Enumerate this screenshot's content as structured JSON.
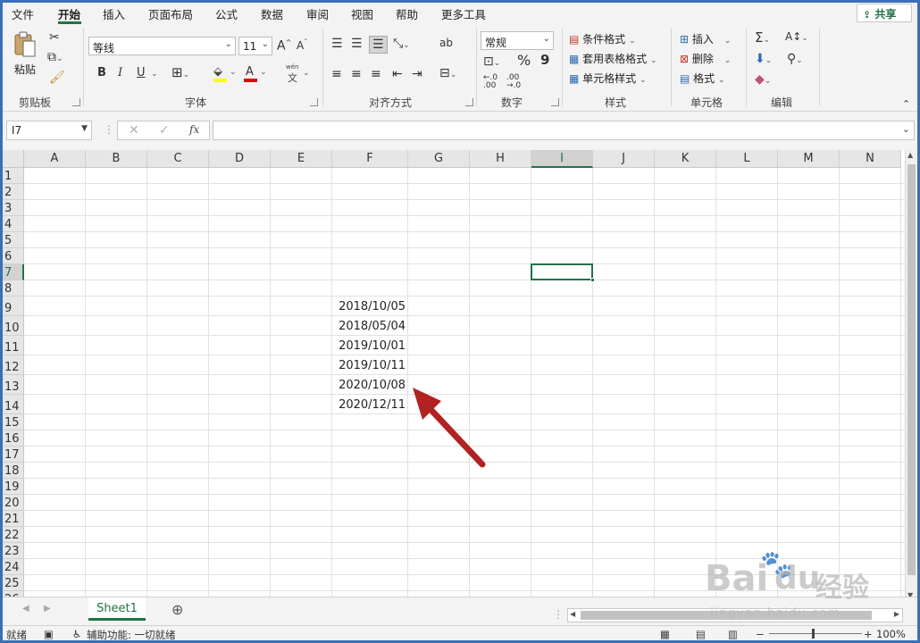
{
  "menu": [
    "文件",
    "开始",
    "插入",
    "页面布局",
    "公式",
    "数据",
    "审阅",
    "视图",
    "帮助",
    "更多工具"
  ],
  "share_label": "共享",
  "ribbon": {
    "clipboard": {
      "paste_label": "粘贴",
      "group_label": "剪贴板"
    },
    "font": {
      "name": "等线",
      "size": "11",
      "group_label": "字体",
      "bold": "B",
      "italic": "I",
      "underline": "U",
      "pinyin": "wén",
      "pinyin_char": "文"
    },
    "alignment": {
      "group_label": "对齐方式"
    },
    "number": {
      "format": "常规",
      "group_label": "数字",
      "percent": "%",
      "comma": "9"
    },
    "styles": {
      "conditional": "条件格式",
      "table": "套用表格格式",
      "cell": "单元格样式",
      "group_label": "样式"
    },
    "cells": {
      "insert": "插入",
      "delete": "删除",
      "format": "格式",
      "group_label": "单元格"
    },
    "editing": {
      "group_label": "编辑"
    }
  },
  "formula_bar": {
    "name_box": "I7",
    "fx": "fx",
    "formula": ""
  },
  "columns": [
    "A",
    "B",
    "C",
    "D",
    "E",
    "F",
    "G",
    "H",
    "I",
    "J",
    "K",
    "L",
    "M",
    "N"
  ],
  "rows": [
    "1",
    "2",
    "3",
    "4",
    "5",
    "6",
    "7",
    "8",
    "9",
    "10",
    "11",
    "12",
    "13",
    "14",
    "15",
    "16",
    "17",
    "18",
    "19",
    "20",
    "21",
    "22",
    "23",
    "24",
    "25",
    "26"
  ],
  "selected_cell": "I7",
  "cells": [
    {
      "ref": "F9",
      "value": "2018/10/05"
    },
    {
      "ref": "F10",
      "value": "2018/05/04"
    },
    {
      "ref": "F11",
      "value": "2019/10/01"
    },
    {
      "ref": "F12",
      "value": "2019/10/11"
    },
    {
      "ref": "F13",
      "value": "2020/10/08"
    },
    {
      "ref": "F14",
      "value": "2020/12/11"
    }
  ],
  "sheet_tab": "Sheet1",
  "status": {
    "ready": "就绪",
    "accessibility": "辅助功能: 一切就绪",
    "zoom": "100%"
  },
  "annotation_color": "#b22222",
  "accent_color": "#217346",
  "watermark": {
    "main": "Bai",
    "main2": "du",
    "cn": "经验",
    "sub": "jingyan.baidu.com"
  }
}
